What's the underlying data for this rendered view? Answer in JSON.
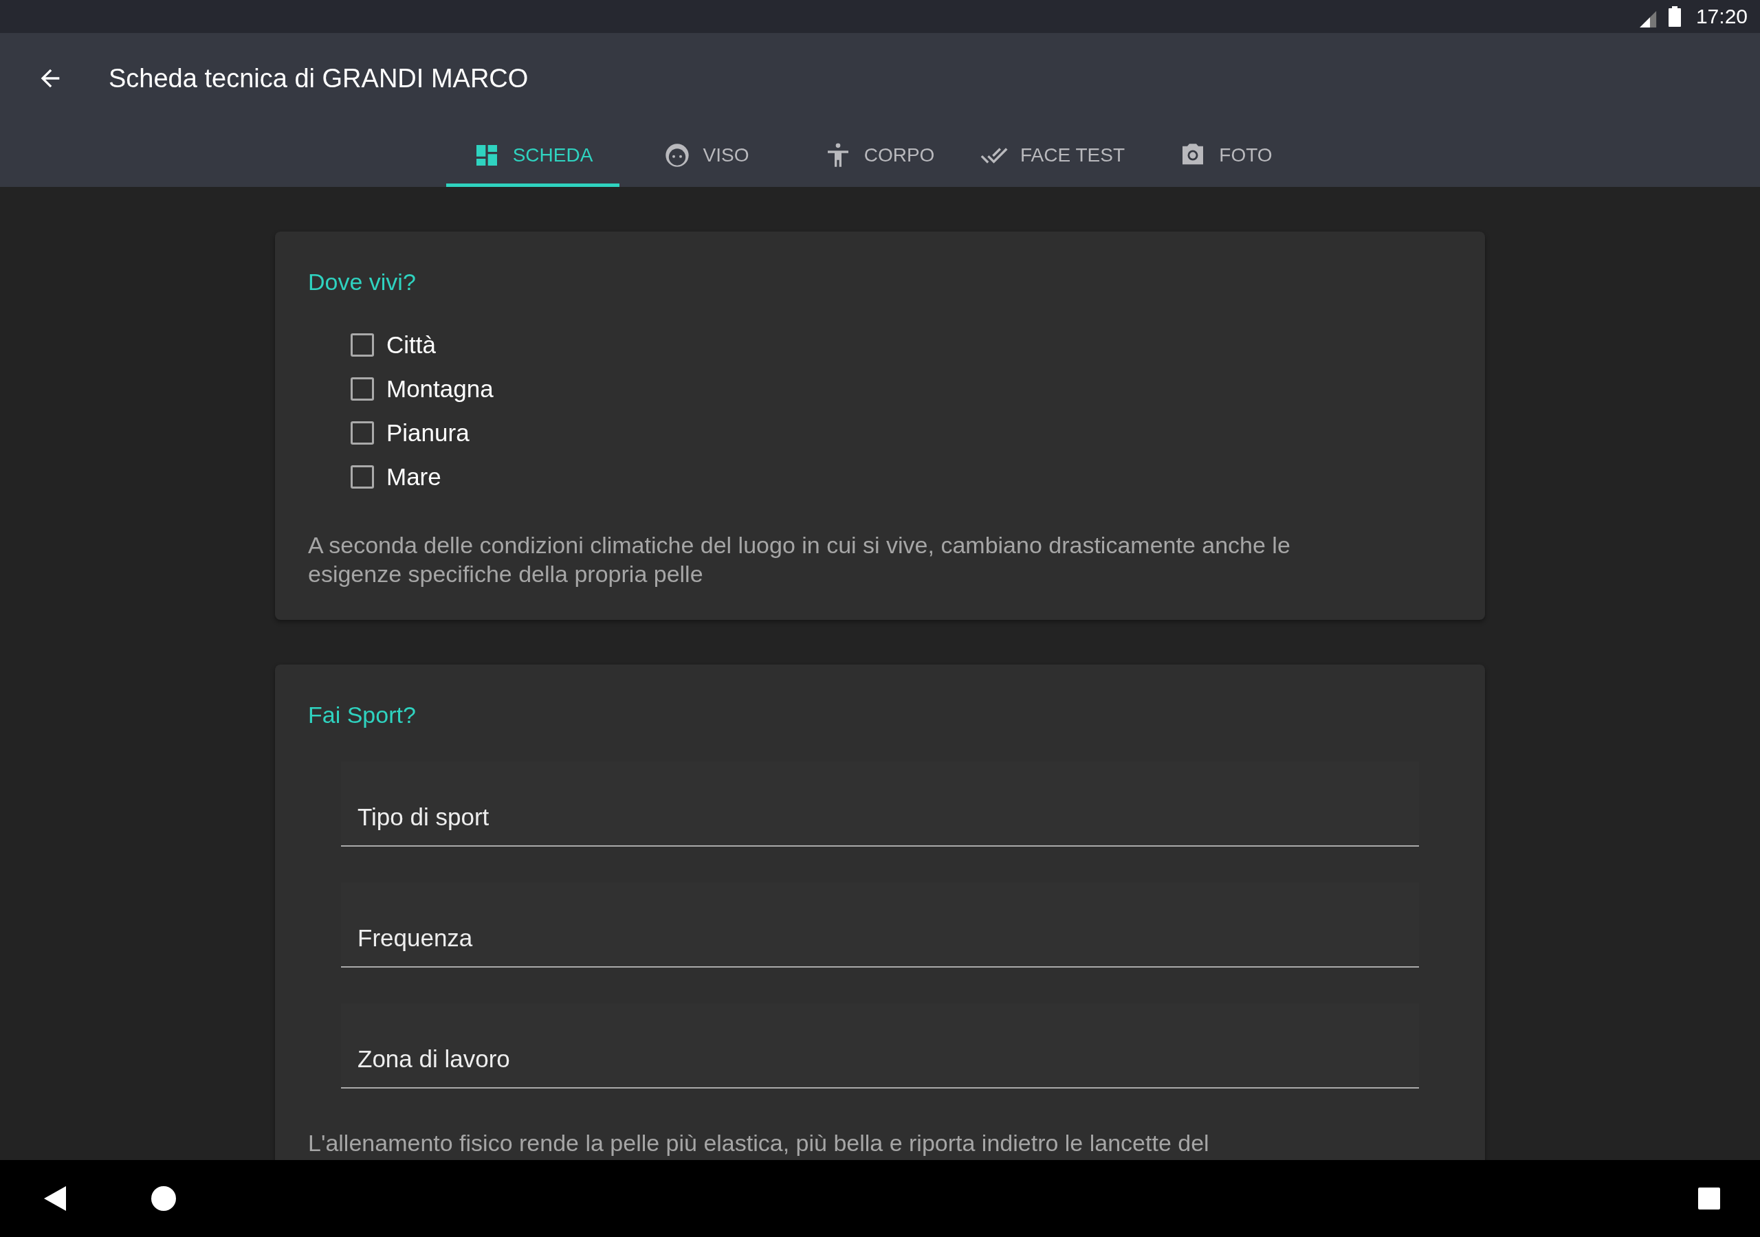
{
  "status_bar": {
    "time": "17:20"
  },
  "app_bar": {
    "title": "Scheda tecnica di GRANDI MARCO"
  },
  "tabs": [
    {
      "label": "SCHEDA",
      "kind": "dashboard",
      "selected": true
    },
    {
      "label": "VISO",
      "kind": "face",
      "selected": false
    },
    {
      "label": "CORPO",
      "kind": "body",
      "selected": false
    },
    {
      "label": "FACE TEST",
      "kind": "done_all",
      "selected": false
    },
    {
      "label": "FOTO",
      "kind": "camera",
      "selected": false
    }
  ],
  "cards": [
    {
      "title": "Dove vivi?",
      "kind": "checkboxes",
      "options": [
        {
          "label": "Città",
          "checked": false
        },
        {
          "label": "Montagna",
          "checked": false
        },
        {
          "label": "Pianura",
          "checked": false
        },
        {
          "label": "Mare",
          "checked": false
        }
      ],
      "note": "A seconda delle condizioni climatiche del luogo in cui si vive, cambiano drasticamente anche le esigenze specifiche della propria pelle"
    },
    {
      "title": "Fai Sport?",
      "kind": "fields",
      "fields": [
        {
          "placeholder": "Tipo di sport"
        },
        {
          "placeholder": "Frequenza"
        },
        {
          "placeholder": "Zona di lavoro"
        }
      ],
      "note": "L'allenamento fisico rende la pelle più elastica, più bella e riporta indietro le lancette del"
    }
  ]
}
